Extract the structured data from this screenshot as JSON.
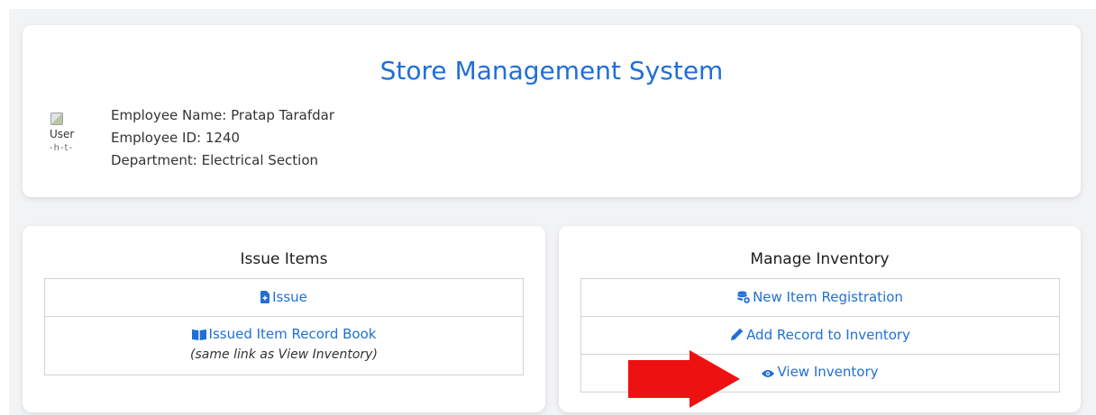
{
  "header": {
    "title": "Store Management System",
    "avatar_alt": "User",
    "avatar_alt_cut": "-h-t-",
    "employee_name": "Employee Name: Pratap Tarafdar",
    "employee_id": "Employee ID: 1240",
    "department": "Department: Electrical Section"
  },
  "issue_section": {
    "title": "Issue Items",
    "items": [
      {
        "label": "Issue",
        "icon": "file-plus-icon"
      },
      {
        "label": "Issued Item Record Book",
        "icon": "open-book-icon",
        "note": "(same link as View Inventory)"
      }
    ]
  },
  "inventory_section": {
    "title": "Manage Inventory",
    "items": [
      {
        "label": "New Item Registration",
        "icon": "database-add-icon"
      },
      {
        "label": "Add Record to Inventory",
        "icon": "pen-icon"
      },
      {
        "label": "View Inventory",
        "icon": "eye-icon"
      }
    ]
  },
  "colors": {
    "accent": "#1f6fd6",
    "background": "#f2f3f5",
    "arrow": "#ee1111"
  }
}
